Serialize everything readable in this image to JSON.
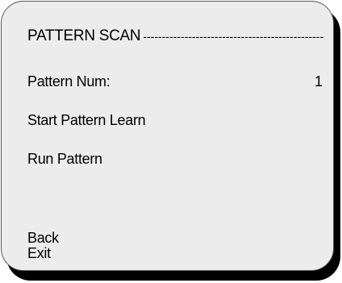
{
  "menu": {
    "title": "PATTERN SCAN",
    "title_rule": "--------------------------------------------------",
    "items": [
      {
        "label": "Pattern Num:",
        "value": "1"
      },
      {
        "label": "Start Pattern Learn"
      },
      {
        "label": "Run Pattern"
      }
    ],
    "back_label": "Back",
    "exit_label": "Exit"
  },
  "colors": {
    "panel_background": "#ececec",
    "shadow": "#000000",
    "text": "#000000"
  }
}
